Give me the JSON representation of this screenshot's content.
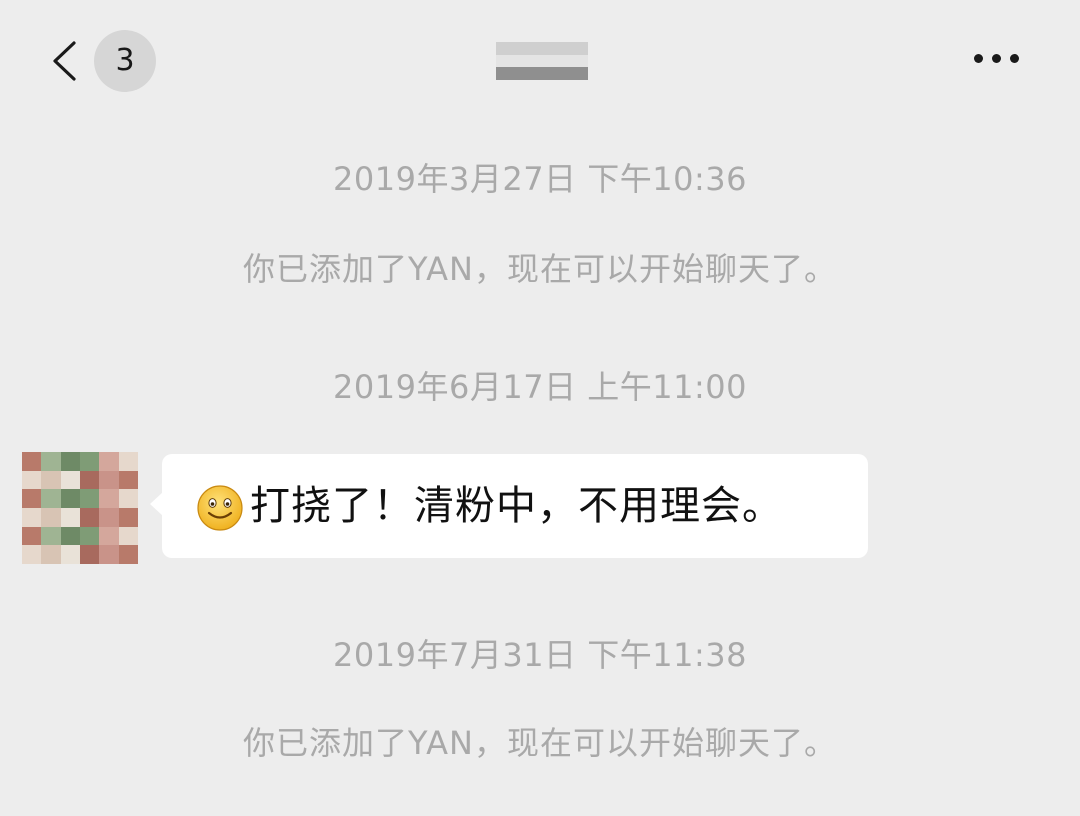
{
  "nav": {
    "unread_count": "3",
    "back_icon": "chevron-left-icon",
    "more_icon": "more-horizontal-icon",
    "title_blurred": true
  },
  "messages": [
    {
      "kind": "timestamp",
      "text": "2019年3月27日 下午10:36"
    },
    {
      "kind": "system",
      "text": "你已添加了YAN，现在可以开始聊天了。"
    },
    {
      "kind": "timestamp",
      "text": "2019年6月17日 上午11:00"
    },
    {
      "kind": "incoming",
      "emoji": "smiling-face-icon",
      "text": "打挠了！清粉中，不用理会。"
    },
    {
      "kind": "timestamp",
      "text": "2019年7月31日 下午11:38"
    },
    {
      "kind": "system",
      "text": "你已添加了YAN，现在可以开始聊天了。"
    }
  ],
  "colors": {
    "background": "#ededed",
    "bubble": "#ffffff",
    "meta_text": "#a9a9a9",
    "message_text": "#111111",
    "badge": "#d6d6d6"
  }
}
